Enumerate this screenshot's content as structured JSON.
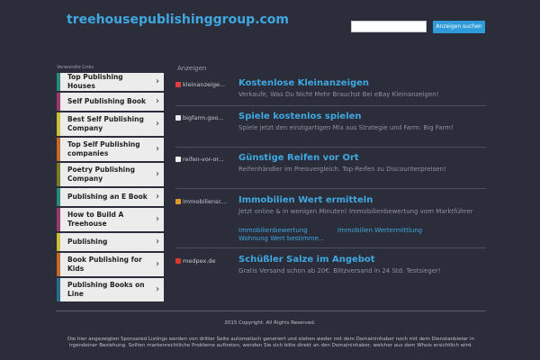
{
  "header": {
    "domain": "treehousepublishinggroup.com",
    "search_button": "Anzeigen suchen",
    "search_placeholder": ""
  },
  "sidebar": {
    "title": "Verwandte Links",
    "items": [
      {
        "label": "Top Publishing Houses",
        "accent": "#2a8a78"
      },
      {
        "label": "Self Publishing Book",
        "accent": "#9a3b6a"
      },
      {
        "label": "Best Self Publishing Company",
        "accent": "#c9c23a"
      },
      {
        "label": "Top Self Publishing companies",
        "accent": "#c86a28"
      },
      {
        "label": "Poetry Publishing Company",
        "accent": "#7a7a2a"
      },
      {
        "label": "Publishing an E Book",
        "accent": "#2a8a78"
      },
      {
        "label": "How to Build A Treehouse",
        "accent": "#9a3b6a"
      },
      {
        "label": "Publishing",
        "accent": "#c9c23a"
      },
      {
        "label": "Book Publishing for Kids",
        "accent": "#c86a28"
      },
      {
        "label": "Publishing Books on Line",
        "accent": "#2a6a8a"
      }
    ]
  },
  "main": {
    "label": "Anzeigen",
    "listings": [
      {
        "source": "kleinanzeige...",
        "icon_color": "#e23c3c",
        "title": "Kostenlose Kleinanzeigen",
        "desc": "Verkaufe, Was Du Nicht Mehr Brauchst Bei eBay Kleinanzeigen!"
      },
      {
        "source": "bigfarm.goo...",
        "icon_color": "#e8e8f0",
        "title": "Spiele kostenlos spielen",
        "desc": "Spiele jetzt den einzigartigen Mix aus Strategie und Farm: Big Farm!"
      },
      {
        "source": "reifen-vor-or...",
        "icon_color": "#f0f0f0",
        "title": "Günstige Reifen vor Ort",
        "desc": "Reifenhändler im Preisvergleich. Top-Reifen zu Discounterpreisen!"
      },
      {
        "source": "immobiliensc...",
        "icon_color": "#e09a2a",
        "title": "Immobilien Wert ermitteln",
        "desc": "Jetzt online & in wenigen Minuten! Immobilienbewertung vom Marktführer",
        "links": [
          "Immobilienbewertung",
          "Immobilien Wertermittlung",
          "Wohnung Wert bestimme..."
        ]
      },
      {
        "source": "medpex.de",
        "icon_color": "#d83a2a",
        "title": "Schüßler Salze im Angebot",
        "desc": "Gratis Versand schon ab 20€. Blitzversand in 24 Std. Testsieger!"
      }
    ]
  },
  "footer": {
    "copyright": "2015 Copyright. All Rights Reserved.",
    "disclaimer": "Die hier angezeigten Sponsored Listings werden von dritter Seite automatisch generiert und stehen weder mit dem Domaininhaber noch mit dem Dienstanbieter in irgendeiner Beziehung. Sollten markenrechtliche Probleme auftreten, wenden Sie sich bitte direkt an den Domaininhaber, welcher aus dem Whois ersichtlich wird."
  }
}
